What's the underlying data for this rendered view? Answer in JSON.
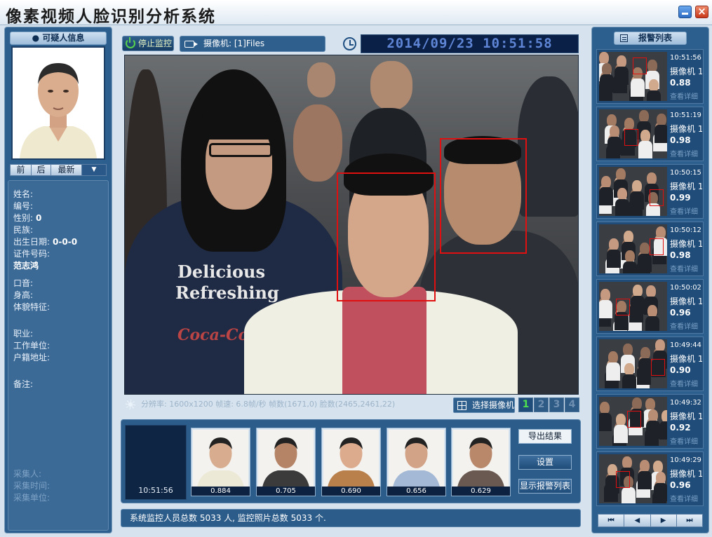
{
  "app": {
    "title": "像素视频人脸识别分析系统"
  },
  "suspect": {
    "panel_title": "可疑人信息",
    "nav": {
      "prev": "前",
      "next": "后",
      "latest": "最新",
      "dropdown": "▼"
    },
    "fields": [
      {
        "label": "姓名:",
        "value": ""
      },
      {
        "label": "编号:",
        "value": ""
      },
      {
        "label": "性别:",
        "value": "0"
      },
      {
        "label": "民族:",
        "value": ""
      },
      {
        "label": "出生日期:",
        "value": "0-0-0"
      },
      {
        "label": "证件号码:",
        "value": ""
      },
      {
        "label": "",
        "value": "范志鸿"
      },
      {
        "label": "口音:",
        "value": ""
      },
      {
        "label": "身高:",
        "value": ""
      },
      {
        "label": "体貌特征:",
        "value": ""
      },
      {
        "label": "职业:",
        "value": ""
      },
      {
        "label": "工作单位:",
        "value": ""
      },
      {
        "label": "户籍地址:",
        "value": ""
      },
      {
        "label": "备注:",
        "value": ""
      }
    ],
    "collect": [
      "采集人:",
      "采集时间:",
      "采集单位:"
    ]
  },
  "toolbar": {
    "stop_label": "停止监控",
    "camera_label": "摄像机: [1]Files",
    "datetime": "2014/09/23 10:51:58"
  },
  "video": {
    "shirt_line1": "Delicious",
    "shirt_line2": "Refreshing",
    "shirt_line3": "Coca-Cola",
    "status": "分辨率: 1600x1200  帧速: 6.8帧/秒  帧数(1671,0) 脸数(2465,2461,22)",
    "select_camera": "选择摄像机",
    "camera_tabs": [
      "1",
      "2",
      "3",
      "4"
    ],
    "active_tab": "1"
  },
  "captures": {
    "time": "10:51:56",
    "items": [
      {
        "score": "0.884",
        "skin": "#d8ad8f",
        "shirt": "#ece9d6"
      },
      {
        "score": "0.705",
        "skin": "#b58467",
        "shirt": "#3b3b3b"
      },
      {
        "score": "0.690",
        "skin": "#dcab8d",
        "shirt": "#b9804c"
      },
      {
        "score": "0.656",
        "skin": "#d3a388",
        "shirt": "#a3b9d6"
      },
      {
        "score": "0.629",
        "skin": "#b9876a",
        "shirt": "#6a5950"
      }
    ],
    "buttons": {
      "export": "导出结果",
      "settings": "设置",
      "show_alarms": "显示报警列表"
    }
  },
  "footer": {
    "summary": "系统监控人员总数 5033 人, 监控照片总数 5033 个."
  },
  "alarms": {
    "title": "报警列表",
    "link_label": "查看详细",
    "items": [
      {
        "time": "10:51:56",
        "camera": "摄像机 1",
        "score": "0.88"
      },
      {
        "time": "10:51:19",
        "camera": "摄像机 1",
        "score": "0.98"
      },
      {
        "time": "10:50:15",
        "camera": "摄像机 1",
        "score": "0.99"
      },
      {
        "time": "10:50:12",
        "camera": "摄像机 1",
        "score": "0.98"
      },
      {
        "time": "10:50:02",
        "camera": "摄像机 1",
        "score": "0.96"
      },
      {
        "time": "10:49:44",
        "camera": "摄像机 1",
        "score": "0.90"
      },
      {
        "time": "10:49:32",
        "camera": "摄像机 1",
        "score": "0.92"
      },
      {
        "time": "10:49:29",
        "camera": "摄像机 1",
        "score": "0.96"
      }
    ],
    "pager": [
      "⏮",
      "◀",
      "▶",
      "⏭"
    ]
  },
  "colors": {
    "accent": "#2d5f8e",
    "alert": "#e01010",
    "active_tab": "#4fe04f"
  }
}
